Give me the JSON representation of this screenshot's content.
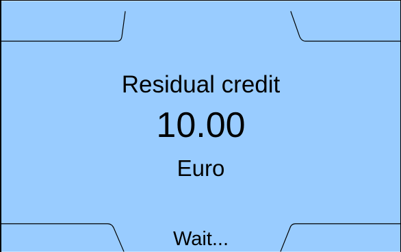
{
  "screen": {
    "background_color": "#99ccff",
    "line_color": "#000000"
  },
  "credit": {
    "title": "Residual credit",
    "amount": "10.00",
    "currency": "Euro"
  },
  "status": {
    "message": "Wait..."
  }
}
